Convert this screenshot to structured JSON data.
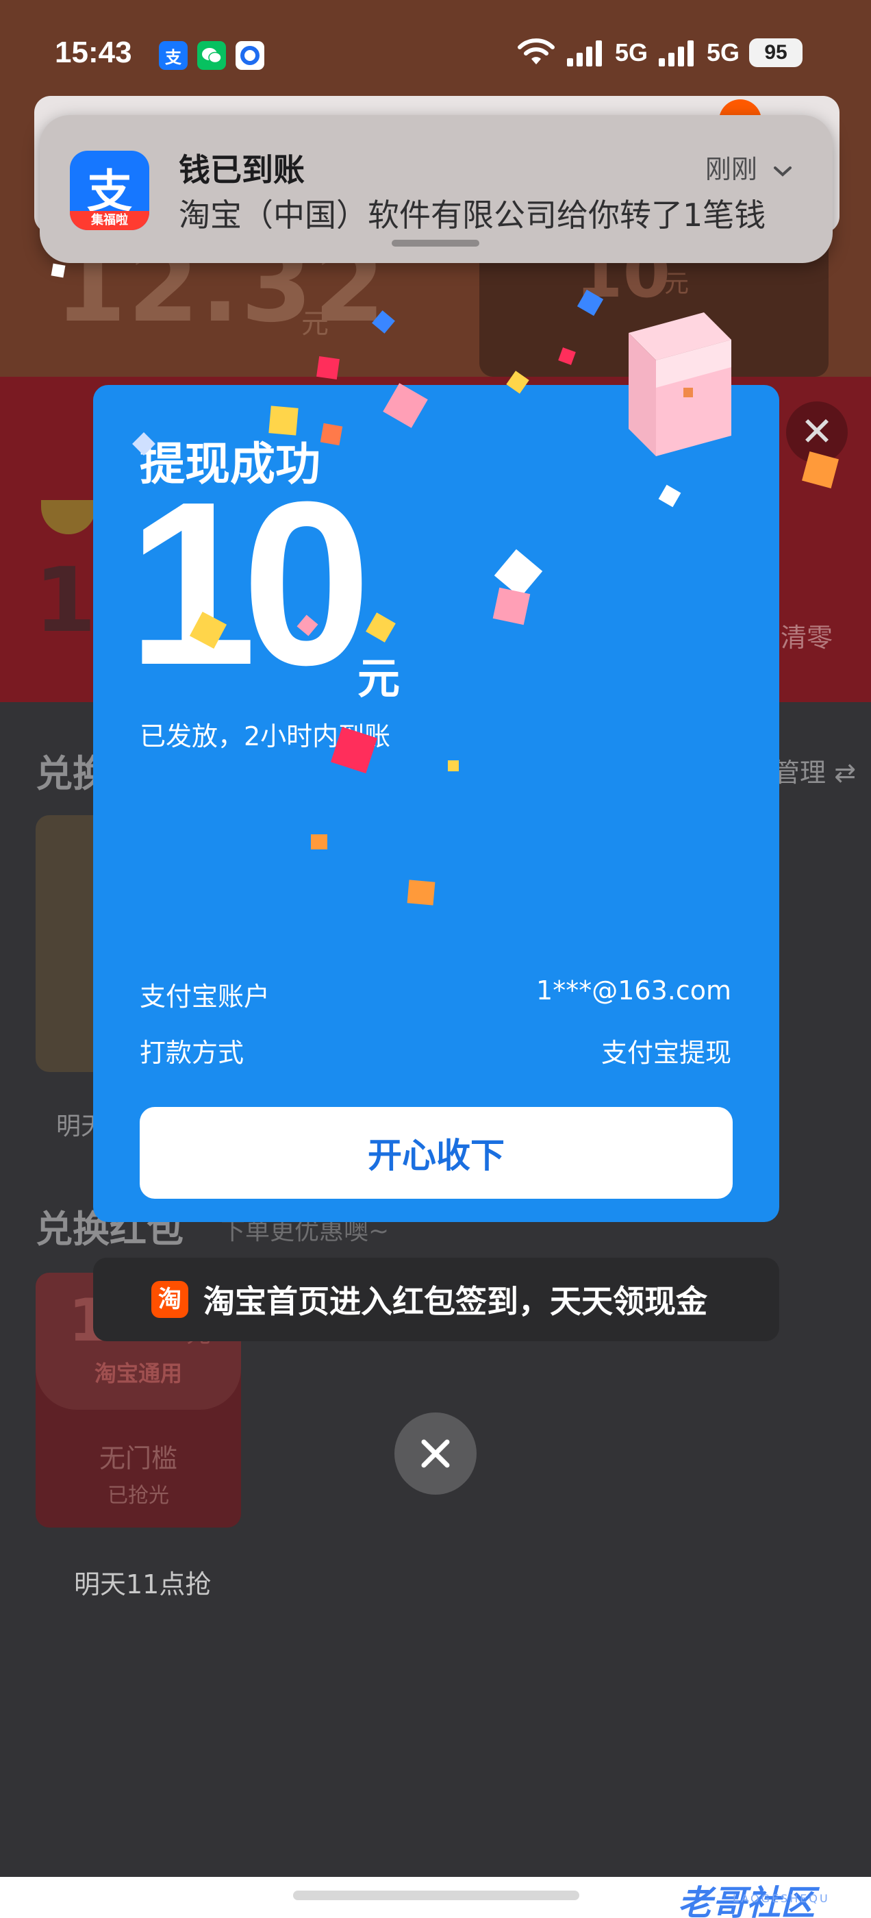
{
  "status_bar": {
    "time": "15:43",
    "apps": [
      {
        "name": "alipay",
        "glyph": "支",
        "color": "#1677ff"
      },
      {
        "name": "wechat",
        "glyph": "微",
        "color": "#07c160"
      },
      {
        "name": "circle-app",
        "glyph": "◎",
        "color": "#1e6cf0"
      }
    ],
    "network_1": "5G",
    "network_2": "5G",
    "battery": "95"
  },
  "notification": {
    "app_icon_glyph": "支",
    "app_icon_band": "集福啦",
    "title": "钱已到账",
    "time": "刚刚",
    "body": "淘宝（中国）软件有限公司给你转了1笔钱"
  },
  "background": {
    "big_number": "12.32",
    "big_unit": "元",
    "card_number": "10",
    "card_unit": "元",
    "clear_text": "清零",
    "red_number": "12",
    "section1_title": "兑换",
    "manage_text": "管理 ⇄",
    "tomorrow_a": "明天",
    "section2_title": "兑换红包",
    "section2_sub": "下单更优惠噢~",
    "coupon": {
      "amount": "12.5",
      "unit": "元",
      "tag": "淘宝通用",
      "condition": "无门槛",
      "status": "已抢光"
    },
    "tomorrow_b": "明天11点抢"
  },
  "modal": {
    "title": "提现成功",
    "amount": "10",
    "unit": "元",
    "note": "已发放，2小时内到账",
    "rows": [
      {
        "label": "支付宝账户",
        "value": "1***@163.com"
      },
      {
        "label": "打款方式",
        "value": "支付宝提现"
      }
    ],
    "button_label": "开心收下"
  },
  "toast": {
    "icon_glyph": "淘",
    "text": "淘宝首页进入红包签到，天天领现金"
  },
  "watermark": {
    "text": "老哥社区",
    "sub": "LAOGESHEQU"
  },
  "colors": {
    "modal_blue": "#1a8cf0",
    "button_text_blue": "#1a6fe0",
    "taobao_orange": "#ff5000",
    "alipay_blue": "#1677ff"
  }
}
